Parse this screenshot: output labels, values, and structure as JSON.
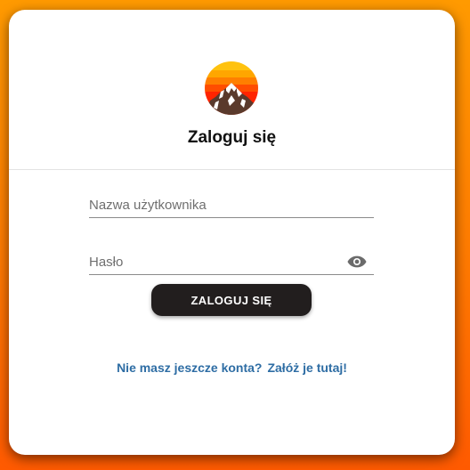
{
  "login": {
    "title": "Zaloguj się",
    "username_placeholder": "Nazwa użytkownika",
    "username_value": "",
    "password_placeholder": "Hasło",
    "password_value": "",
    "submit_label": "ZALOGUJ SIĘ",
    "signup_prompt": "Nie masz jeszcze konta?",
    "signup_link": "Załóż je tutaj!"
  },
  "icons": {
    "logo": "mountain-sunset-logo",
    "password_toggle": "eye-icon"
  },
  "colors": {
    "background_top": "#ff9a00",
    "background_bottom": "#ff5a00",
    "card": "#ffffff",
    "button": "#221e1e",
    "link": "#2e6da4"
  }
}
